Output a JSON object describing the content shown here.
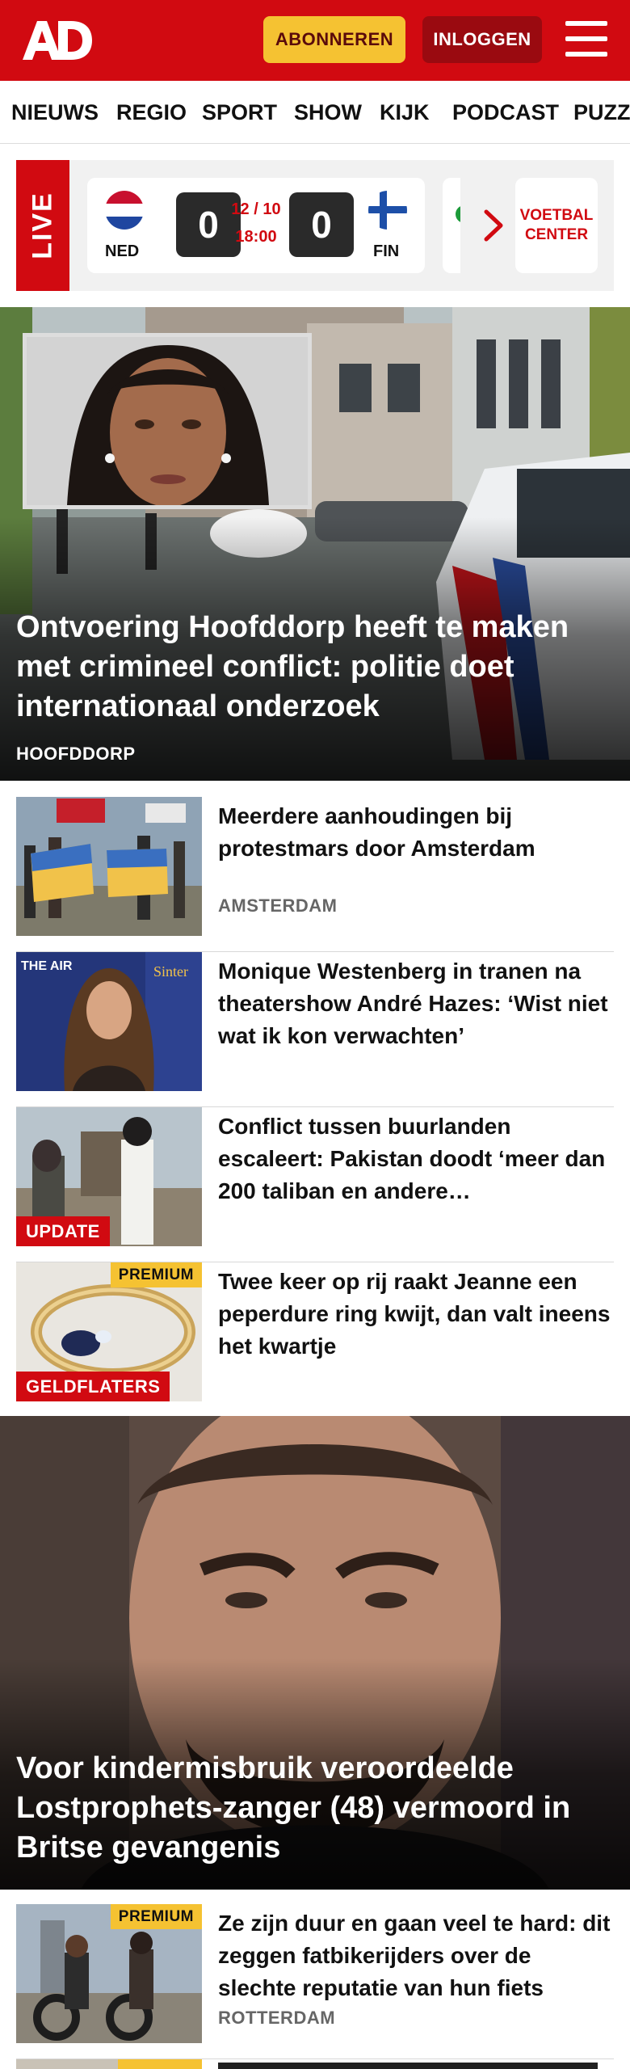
{
  "header": {
    "logo_text": "AD",
    "subscribe_label": "ABONNEREN",
    "login_label": "INLOGGEN",
    "brand_color": "#d10a11",
    "menu_icon": "hamburger-menu-icon"
  },
  "nav": {
    "items": [
      "NIEUWS",
      "REGIO",
      "SPORT",
      "SHOW",
      "KIJK",
      "PODCAST",
      "PUZZ"
    ]
  },
  "live": {
    "label": "LIVE",
    "match": {
      "home": "NED",
      "away": "FIN",
      "home_score": "0",
      "away_score": "0",
      "date": "12 / 10",
      "time": "18:00"
    },
    "center_line1": "VOETBAL",
    "center_line2": "CENTER"
  },
  "hero": {
    "title": "Ontvoering Hoofddorp heeft te maken met crimineel conflict: politie doet internationaal onderzoek",
    "label": "HOOFDDORP"
  },
  "articles": [
    {
      "title": "Meerdere aanhoudingen bij protestmars door Amsterdam",
      "label": "AMSTERDAM",
      "badge": "",
      "premium": ""
    },
    {
      "title": "Monique Westenberg in tranen na theatershow André Hazes: ‘Wist niet wat ik kon verwachten’",
      "label": "",
      "badge": "",
      "premium": ""
    },
    {
      "title": "Conflict tussen buurlanden escaleert: Pakistan doodt ‘meer dan 200 taliban en andere…",
      "label": "",
      "badge": "UPDATE",
      "premium": ""
    },
    {
      "title": "Twee keer op rij raakt Jeanne een peperdure ring kwijt, dan valt ineens het kwartje",
      "label": "",
      "badge": "GELDFLATERS",
      "premium": "PREMIUM"
    }
  ],
  "hero2": {
    "title": "Voor kindermisbruik veroordeelde Lostprophets-zanger (48) vermoord in Britse gevangenis"
  },
  "article_after": {
    "title": "Ze zijn duur en gaan veel te hard: dit zeggen fatbikerijders over de slechte reputatie van hun fiets",
    "label": "ROTTERDAM",
    "premium": "PREMIUM"
  }
}
